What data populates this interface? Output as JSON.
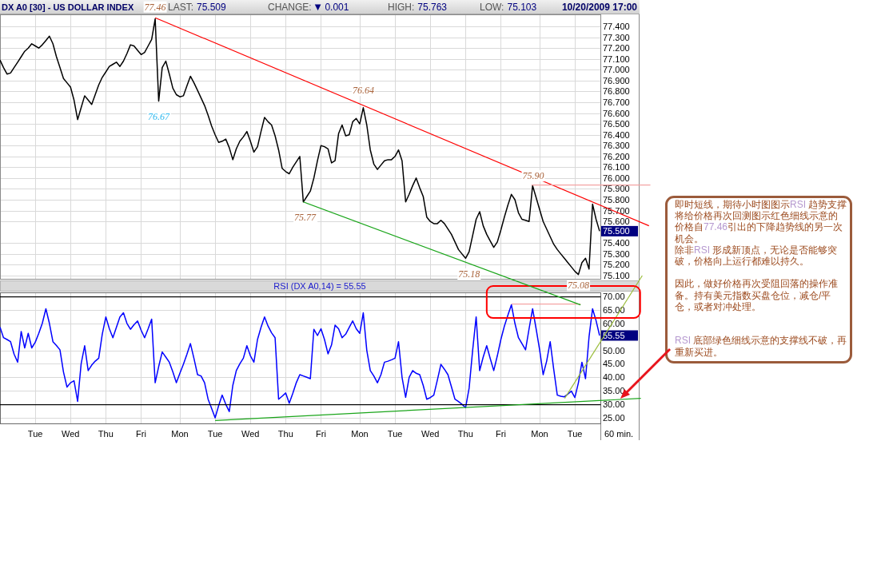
{
  "header": {
    "title": "DX A0 [30] - US DOLLAR INDEX",
    "stats": [
      {
        "label": "LAST:",
        "value": "75.509"
      },
      {
        "label": "CHANGE:",
        "arrow": "▼",
        "value": "0.001"
      },
      {
        "label": "HIGH:",
        "value": "75.763"
      },
      {
        "label": "LOW:",
        "value": "75.103"
      }
    ],
    "timestamp": "10/20/2009 17:00"
  },
  "price_panel": {
    "last_label": "75.500",
    "chart_data": {
      "type": "line",
      "categories": [
        null,
        null,
        null,
        null,
        null,
        null,
        null,
        null,
        null,
        null,
        null,
        null,
        null,
        null,
        null,
        null,
        null,
        null,
        null,
        null,
        null,
        null,
        null,
        null,
        null,
        null,
        null,
        null,
        null,
        null,
        null,
        null,
        null,
        null,
        null,
        null,
        null,
        null,
        null,
        null,
        null,
        null,
        null,
        null,
        null,
        null,
        null,
        null,
        null,
        null,
        null,
        null,
        null,
        null,
        null,
        null,
        null,
        null,
        null,
        null,
        null,
        null,
        null,
        null,
        null,
        null,
        null,
        null,
        null,
        null,
        null,
        null,
        null,
        null,
        null,
        null,
        null,
        null,
        null,
        null,
        null,
        null,
        null,
        null,
        null,
        null,
        null,
        null,
        null,
        null,
        null,
        null,
        null,
        null,
        null,
        null,
        null,
        null,
        null,
        null,
        null,
        null,
        null,
        null,
        null,
        null,
        null,
        null,
        null,
        null,
        null,
        null,
        null,
        null,
        null,
        null,
        null,
        null,
        null,
        null,
        null,
        null,
        null,
        null,
        null,
        null,
        null,
        null,
        null,
        null,
        null,
        null,
        null,
        null,
        null,
        null,
        null,
        null,
        null,
        null,
        null,
        null,
        null,
        null,
        null,
        null,
        null,
        null,
        null,
        null,
        null,
        null,
        null,
        null,
        null,
        null,
        null,
        null,
        null,
        null,
        null,
        null,
        null,
        null,
        null,
        null,
        null,
        null,
        null,
        null,
        null
      ],
      "series": [
        {
          "color": "#000000",
          "values": [
            77.09,
            77.02,
            76.96,
            76.97,
            77.02,
            77.07,
            77.12,
            77.17,
            77.2,
            77.24,
            77.22,
            77.2,
            77.23,
            77.27,
            77.31,
            77.24,
            77.12,
            77.02,
            76.92,
            76.88,
            76.84,
            76.72,
            76.54,
            76.65,
            76.76,
            76.72,
            76.68,
            76.77,
            76.86,
            76.93,
            76.98,
            77.03,
            77.05,
            77.07,
            77.03,
            77.08,
            77.15,
            77.23,
            77.22,
            77.18,
            77.14,
            77.16,
            77.22,
            77.28,
            77.47,
            76.71,
            77.02,
            77.08,
            76.96,
            76.83,
            76.77,
            76.75,
            76.76,
            76.85,
            76.94,
            76.88,
            76.81,
            76.74,
            76.67,
            76.58,
            76.48,
            76.4,
            76.33,
            76.34,
            76.36,
            76.28,
            76.17,
            76.27,
            76.34,
            76.38,
            76.43,
            76.34,
            76.24,
            76.29,
            76.43,
            76.56,
            76.52,
            76.49,
            76.39,
            76.26,
            76.09,
            76.06,
            76.04,
            76.1,
            76.15,
            76.2,
            75.78,
            75.83,
            75.88,
            76.0,
            76.16,
            76.3,
            76.29,
            76.27,
            76.14,
            76.16,
            76.41,
            76.49,
            76.39,
            76.4,
            76.52,
            76.55,
            76.5,
            76.65,
            76.49,
            76.26,
            76.13,
            76.08,
            76.12,
            76.16,
            76.17,
            76.17,
            76.2,
            76.26,
            76.16,
            75.78,
            75.85,
            75.93,
            76.0,
            75.91,
            75.83,
            75.64,
            75.6,
            75.58,
            75.58,
            75.61,
            75.58,
            75.53,
            75.48,
            75.41,
            75.34,
            75.3,
            75.26,
            75.32,
            75.47,
            75.62,
            75.69,
            75.56,
            75.48,
            75.42,
            75.36,
            75.41,
            75.52,
            75.64,
            75.75,
            75.85,
            75.8,
            75.68,
            75.62,
            75.61,
            75.6,
            75.93,
            75.82,
            75.71,
            75.6,
            75.53,
            75.46,
            75.39,
            75.34,
            75.3,
            75.26,
            75.22,
            75.18,
            75.14,
            75.11,
            75.22,
            75.26,
            75.16,
            75.76,
            75.62,
            75.51
          ]
        }
      ],
      "ylim": [
        75.063,
        77.511
      ],
      "yticks": [
        {
          "value": 75.1,
          "label": "75.100"
        },
        {
          "value": 75.2,
          "label": "75.200"
        },
        {
          "value": 75.3,
          "label": "75.300"
        },
        {
          "value": 75.4,
          "label": "75.400"
        },
        {
          "value": 75.6,
          "label": "75.600"
        },
        {
          "value": 75.7,
          "label": "75.700"
        },
        {
          "value": 75.8,
          "label": "75.800"
        },
        {
          "value": 75.9,
          "label": "75.900"
        },
        {
          "value": 76.0,
          "label": "76.000"
        },
        {
          "value": 76.1,
          "label": "76.100"
        },
        {
          "value": 76.2,
          "label": "76.200"
        },
        {
          "value": 76.3,
          "label": "76.300"
        },
        {
          "value": 76.4,
          "label": "76.400"
        },
        {
          "value": 76.5,
          "label": "76.500"
        },
        {
          "value": 76.6,
          "label": "76.600"
        },
        {
          "value": 76.7,
          "label": "76.700"
        },
        {
          "value": 76.8,
          "label": "76.800"
        },
        {
          "value": 76.9,
          "label": "76.900"
        },
        {
          "value": 77.0,
          "label": "77.000"
        },
        {
          "value": 77.1,
          "label": "77.100"
        },
        {
          "value": 77.2,
          "label": "77.200"
        },
        {
          "value": 77.3,
          "label": "77.300"
        },
        {
          "value": 77.4,
          "label": "77.400"
        }
      ],
      "annotations": [
        "77.46",
        "76.67",
        "76.64",
        "75.77",
        "75.90",
        "75.18",
        "75.08"
      ]
    },
    "drawings": [
      {
        "kind": "line",
        "color": "#ff0000"
      },
      {
        "kind": "line",
        "color": "#1aa51a"
      },
      {
        "kind": "hline",
        "color": "#f4a0a0"
      }
    ]
  },
  "rsi_panel": {
    "last_label": "55.55",
    "chart_data": {
      "type": "line",
      "title": "RSI (DX A0,14) = 55.55",
      "xlabel": "60 min.",
      "categories": [
        null,
        null,
        null,
        null,
        null,
        null,
        null,
        null,
        null,
        null,
        "Tue",
        null,
        null,
        null,
        null,
        null,
        null,
        null,
        null,
        null,
        "Wed",
        null,
        null,
        null,
        null,
        null,
        null,
        null,
        null,
        null,
        "Thu",
        null,
        null,
        null,
        null,
        null,
        null,
        null,
        null,
        null,
        "Fri",
        null,
        null,
        null,
        null,
        null,
        null,
        null,
        null,
        null,
        null,
        "Mon",
        null,
        null,
        null,
        null,
        null,
        null,
        null,
        null,
        null,
        "Tue",
        null,
        null,
        null,
        null,
        null,
        null,
        null,
        null,
        null,
        "Wed",
        null,
        null,
        null,
        null,
        null,
        null,
        null,
        null,
        null,
        "Thu",
        null,
        null,
        null,
        null,
        null,
        null,
        null,
        null,
        null,
        "Fri",
        null,
        null,
        null,
        null,
        null,
        null,
        null,
        null,
        null,
        null,
        "Mon",
        null,
        null,
        null,
        null,
        null,
        null,
        null,
        null,
        null,
        "Tue",
        null,
        null,
        null,
        null,
        null,
        null,
        null,
        null,
        null,
        "Wed",
        null,
        null,
        null,
        null,
        null,
        null,
        null,
        null,
        null,
        "Thu",
        null,
        null,
        null,
        null,
        null,
        null,
        null,
        null,
        null,
        "Fri",
        null,
        null,
        null,
        null,
        null,
        null,
        null,
        null,
        null,
        null,
        "Mon",
        null,
        null,
        null,
        null,
        null,
        null,
        null,
        null,
        null,
        "Tue",
        null,
        null,
        null,
        null,
        null,
        null,
        null
      ],
      "series": [
        {
          "color": "#0000ff",
          "values": [
            58.6,
            54.7,
            54.0,
            53.2,
            48.6,
            45.6,
            57.0,
            50.9,
            56.3,
            50.9,
            53.0,
            56.3,
            60.0,
            65.4,
            60.0,
            53.2,
            51.8,
            50.2,
            42.0,
            36.4,
            38.0,
            38.7,
            31.1,
            45.0,
            51.7,
            42.5,
            44.5,
            46.0,
            47.1,
            56.0,
            62.4,
            58.0,
            54.7,
            58.5,
            62.4,
            63.9,
            60.0,
            57.8,
            59.5,
            60.9,
            57.5,
            54.7,
            58.0,
            61.6,
            38.0,
            44.0,
            49.4,
            47.5,
            45.6,
            42.0,
            38.0,
            41.5,
            44.8,
            48.5,
            52.5,
            47.0,
            41.0,
            40.5,
            38.0,
            31.9,
            28.5,
            25.0,
            29.5,
            33.4,
            30.0,
            27.3,
            37.0,
            42.5,
            45.0,
            47.1,
            51.7,
            48.0,
            45.6,
            54.0,
            58.5,
            62.4,
            59.0,
            56.5,
            54.7,
            31.9,
            33.0,
            34.2,
            30.4,
            34.0,
            38.0,
            41.0,
            40.5,
            40.0,
            39.5,
            57.8,
            55.5,
            58.0,
            54.0,
            48.7,
            52.0,
            59.3,
            58.0,
            54.7,
            56.0,
            58.5,
            60.9,
            58.0,
            56.3,
            63.9,
            50.0,
            42.5,
            40.5,
            38.0,
            41.0,
            45.6,
            46.0,
            46.5,
            47.1,
            53.2,
            40.0,
            32.6,
            40.0,
            42.5,
            41.5,
            41.0,
            37.0,
            31.9,
            32.5,
            33.4,
            39.0,
            44.8,
            43.0,
            41.0,
            36.5,
            31.9,
            31.0,
            30.0,
            28.8,
            36.0,
            50.0,
            62.4,
            42.5,
            47.5,
            51.7,
            47.0,
            42.5,
            48.0,
            54.0,
            59.0,
            63.0,
            66.9,
            60.0,
            54.7,
            52.5,
            50.2,
            58.0,
            65.4,
            58.0,
            50.2,
            41.0,
            46.0,
            53.2,
            43.0,
            33.4,
            33.0,
            32.8,
            33.8,
            34.9,
            32.5,
            38.0,
            45.6,
            39.5,
            55.0,
            65.4,
            61.0,
            55.5
          ]
        }
      ],
      "ylim": [
        22.93,
        71.48
      ],
      "yticks": [
        {
          "value": 25,
          "label": "25.00"
        },
        {
          "value": 30,
          "label": "30.00"
        },
        {
          "value": 35,
          "label": "35.00"
        },
        {
          "value": 40,
          "label": "40.00"
        },
        {
          "value": 45,
          "label": "45.00"
        },
        {
          "value": 50,
          "label": "50.00"
        },
        {
          "value": 60,
          "label": "60.00"
        },
        {
          "value": 65,
          "label": "65.00"
        },
        {
          "value": 70,
          "label": "70.00"
        }
      ]
    },
    "drawings": [
      {
        "kind": "hline",
        "color": "#000000"
      },
      {
        "kind": "hline",
        "color": "#000000"
      },
      {
        "kind": "line",
        "color": "#1aa51a"
      },
      {
        "kind": "line",
        "color": "#9bbd3c"
      },
      {
        "kind": "hline",
        "color": "#f4a0a0"
      },
      {
        "kind": "frame",
        "color": "#ff0000"
      }
    ]
  },
  "note": {
    "paragraphs": [
      {
        "runs": [
          {
            "text": "即时短线，期待小时图图示",
            "accent": false
          },
          {
            "text": "RSI",
            "accent": true
          },
          {
            "text": " 趋势支撑将给价格再次回测图示红色细线示意的价格自",
            "accent": false
          },
          {
            "text": "77.46",
            "accent": true
          },
          {
            "text": "引出的下降趋势线的另一次机会。",
            "accent": false
          }
        ]
      },
      {
        "runs": [
          {
            "text": "除非",
            "accent": false
          },
          {
            "text": "RSI",
            "accent": true
          },
          {
            "text": " 形成新顶点，无论是否能够突破，价格向上运行都难以持久。",
            "accent": false
          }
        ]
      },
      {
        "runs": [
          {
            "text": "因此，做好价格再次受阻回落的操作准备。持有美元指数买盘仓位，减仓/平仓，或者对冲处理。",
            "accent": false
          }
        ]
      },
      {
        "runs": [
          {
            "text": "RSI",
            "accent": true
          },
          {
            "text": " 底部绿色细线示意的支撑线不破，再重新买进。",
            "accent": false
          }
        ]
      }
    ]
  }
}
